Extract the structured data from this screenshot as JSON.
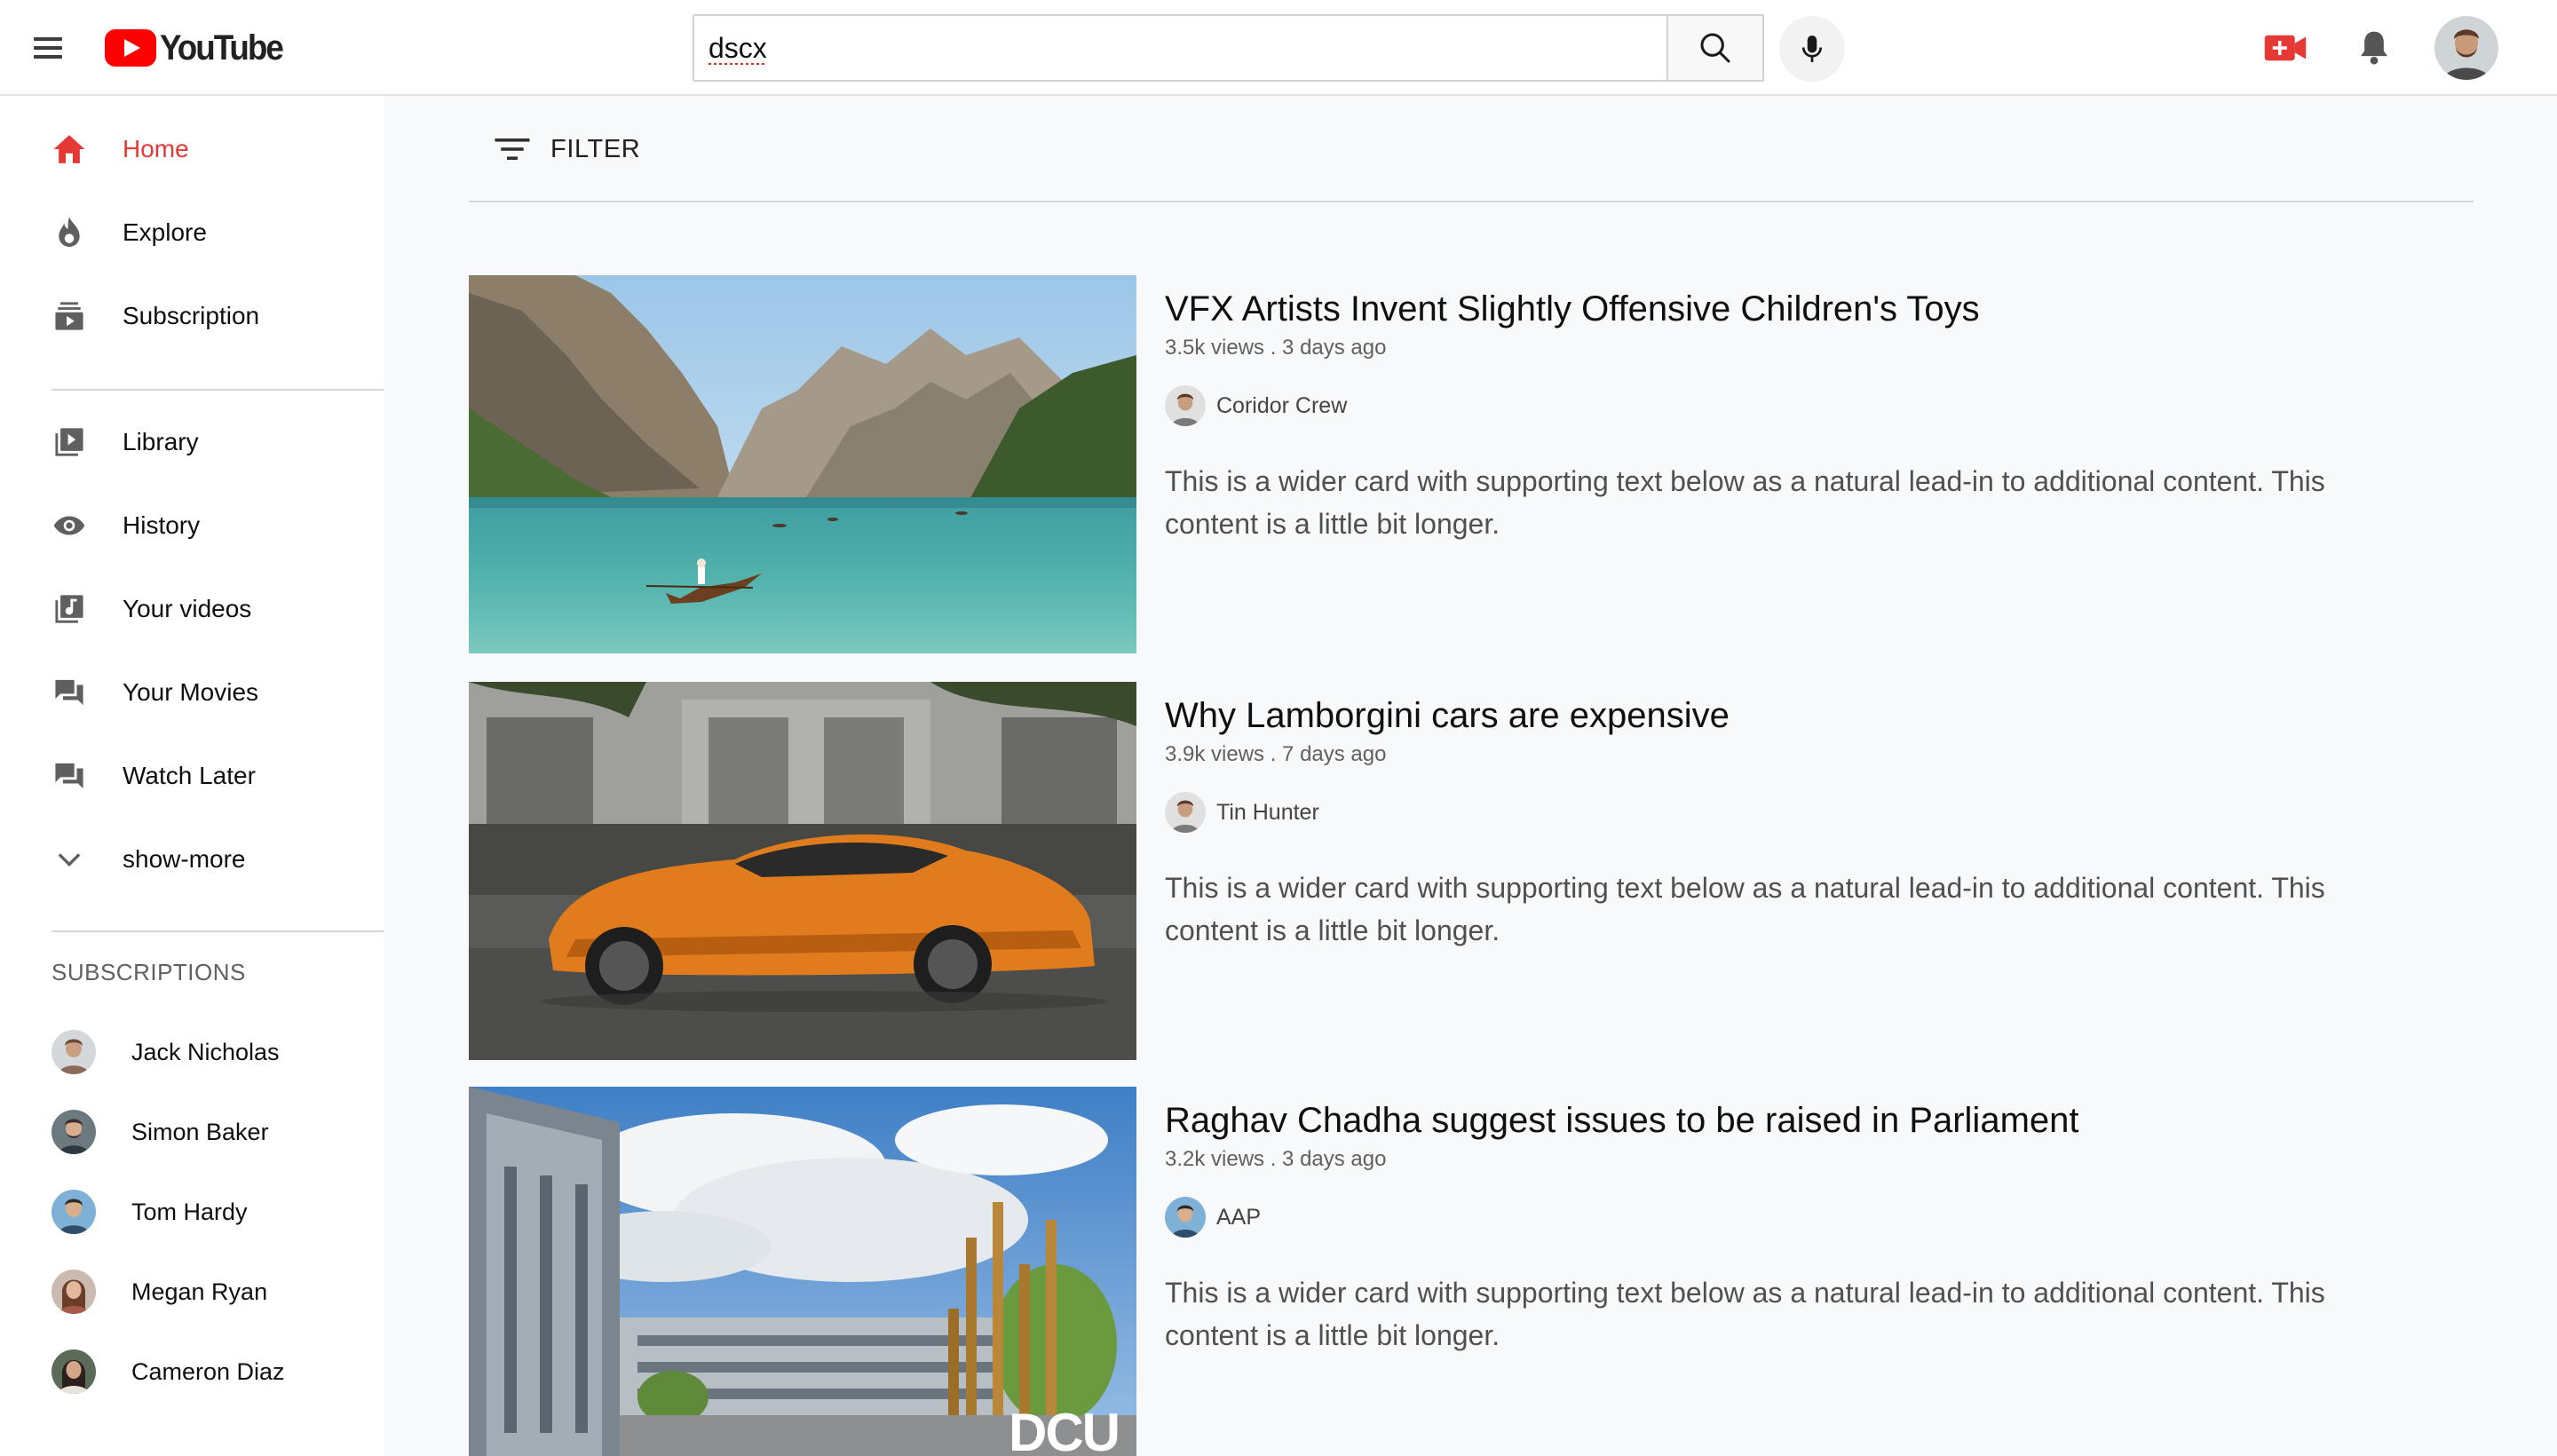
{
  "header": {
    "logo_text": "YouTube",
    "search": {
      "value": "dscx",
      "placeholder": "Search"
    }
  },
  "sidebar": {
    "nav": [
      {
        "label": "Home",
        "icon": "home-icon"
      },
      {
        "label": "Explore",
        "icon": "explore-icon"
      },
      {
        "label": "Subscription",
        "icon": "subscriptions-icon"
      },
      {
        "label": "Library",
        "icon": "library-icon"
      },
      {
        "label": "History",
        "icon": "history-icon"
      },
      {
        "label": "Your videos",
        "icon": "your-videos-icon"
      },
      {
        "label": "Your Movies",
        "icon": "movies-icon"
      },
      {
        "label": "Watch Later",
        "icon": "watch-later-icon"
      },
      {
        "label": "show-more",
        "icon": "chevron-down-icon"
      }
    ],
    "subscriptions_heading": "SUBSCRIPTIONS",
    "subscriptions": [
      {
        "name": "Jack Nicholas"
      },
      {
        "name": "Simon Baker"
      },
      {
        "name": "Tom Hardy"
      },
      {
        "name": "Megan Ryan"
      },
      {
        "name": "Cameron Diaz"
      }
    ]
  },
  "main": {
    "filter_label": "FILTER",
    "videos": [
      {
        "title": "VFX Artists Invent Slightly Offensive Children's Toys",
        "meta": "3.5k views . 3 days ago",
        "channel": "Coridor Crew",
        "description": "This is a wider card with supporting text below as a natural lead-in to additional content. This content is a little bit longer."
      },
      {
        "title": "Why Lamborgini cars are expensive",
        "meta": "3.9k views . 7 days ago",
        "channel": "Tin Hunter",
        "description": "This is a wider card with supporting text below as a natural lead-in to additional content. This content is a little bit longer."
      },
      {
        "title": "Raghav Chadha suggest issues to be raised in Parliament",
        "meta": "3.2k views . 3 days ago",
        "channel": "AAP",
        "description": "This is a wider card with supporting text below as a natural lead-in to additional content. This content is a little bit longer.",
        "thumbnail_text": "DCU"
      }
    ]
  },
  "colors": {
    "brand_red": "#ff0000",
    "active_red": "#e53935",
    "main_bg": "#f8f9fa"
  }
}
